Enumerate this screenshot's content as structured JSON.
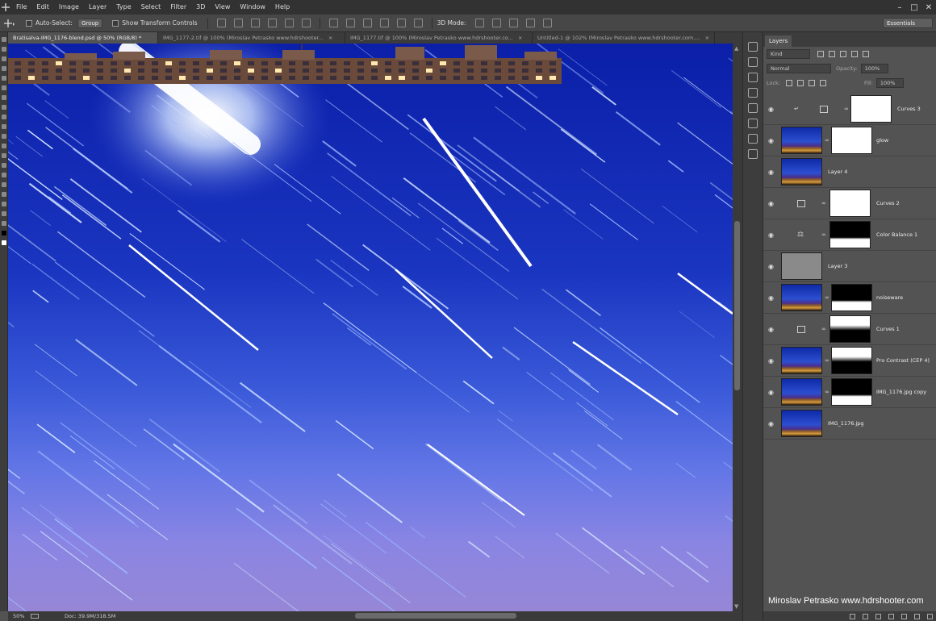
{
  "menu": [
    "File",
    "Edit",
    "Image",
    "Layer",
    "Type",
    "Select",
    "Filter",
    "3D",
    "View",
    "Window",
    "Help"
  ],
  "options": {
    "auto_select_label": "Auto-Select:",
    "auto_select_value": "Group",
    "transform_label": "Show Transform Controls",
    "mode_label": "3D Mode:",
    "workspace": "Essentials"
  },
  "tabs": [
    {
      "label": "Bratisalva-IMG_1176-blend.psd @ 50% (RGB/8) *",
      "active": true
    },
    {
      "label": "IMG_1177-2.tif @ 100% (Miroslav Petrasko www.hdrshooter...",
      "active": false
    },
    {
      "label": "IMG_1177.tif @ 100% (Miroslav Petrasko www.hdrshooter.co...",
      "active": false
    },
    {
      "label": "Untitled-1 @ 102% (Miroslav Petrasko www.hdrshooter.com....",
      "active": false
    }
  ],
  "status": {
    "zoom": "50%",
    "doc": "Doc: 39.9M/318.5M"
  },
  "layers_panel": {
    "title": "Layers",
    "filter": "Kind",
    "blend_mode": "Normal",
    "opacity_label": "Opacity:",
    "opacity_value": "100%",
    "lock_label": "Lock:",
    "fill_label": "Fill:",
    "fill_value": "100%"
  },
  "layers": [
    {
      "name": "Curves 3",
      "kind": "adjustment",
      "clipped": true
    },
    {
      "name": "glow",
      "kind": "photo-mask"
    },
    {
      "name": "Layer 4",
      "kind": "photo"
    },
    {
      "name": "Curves 2",
      "kind": "adjustment"
    },
    {
      "name": "Color Balance 1",
      "kind": "balance"
    },
    {
      "name": "Layer 3",
      "kind": "gray"
    },
    {
      "name": "noiseware",
      "kind": "photo-mask-bottom"
    },
    {
      "name": "Curves 1",
      "kind": "adjustment-mask"
    },
    {
      "name": "Pro Contrast (CEP 4)",
      "kind": "photo-mask-top"
    },
    {
      "name": "IMG_1176.jpg copy",
      "kind": "photo-mask-bottom"
    },
    {
      "name": "IMG_1176.jpg",
      "kind": "photo"
    }
  ],
  "watermark": "Miroslav  Petrasko  www.hdrshooter.com"
}
